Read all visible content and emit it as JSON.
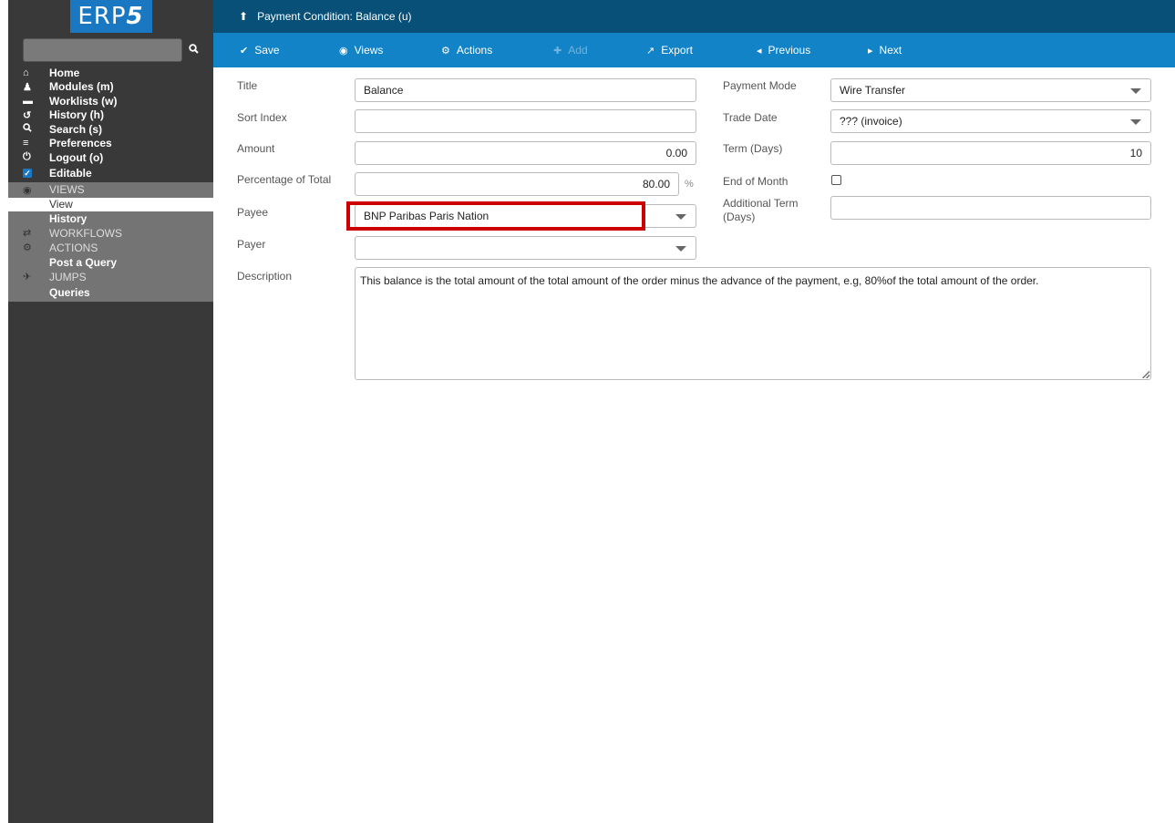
{
  "sidebar": {
    "logo": {
      "text": "ERP",
      "digit": "5"
    },
    "search": {
      "value": "",
      "placeholder": ""
    },
    "items": [
      {
        "label": "Home",
        "icon": "home-icon"
      },
      {
        "label": "Modules (m)",
        "icon": "puzzle-icon"
      },
      {
        "label": "Worklists (w)",
        "icon": "inbox-icon"
      },
      {
        "label": "History (h)",
        "icon": "history-icon"
      },
      {
        "label": "Search (s)",
        "icon": "search-icon"
      },
      {
        "label": "Preferences",
        "icon": "sliders-icon"
      },
      {
        "label": "Logout (o)",
        "icon": "power-icon"
      },
      {
        "label": "Editable",
        "icon": "checkbox-checked-icon"
      }
    ],
    "groups": {
      "views_header": "VIEWS",
      "view": "View",
      "history": "History",
      "workflows_header": "WORKFLOWS",
      "actions_header": "ACTIONS",
      "post_query": "Post a Query",
      "jumps_header": "JUMPS",
      "queries": "Queries"
    }
  },
  "header": {
    "title": "Payment Condition: Balance (u)"
  },
  "toolbar": {
    "save": "Save",
    "views": "Views",
    "actions": "Actions",
    "add": "Add",
    "export": "Export",
    "previous": "Previous",
    "next": "Next"
  },
  "form": {
    "title": {
      "label": "Title",
      "value": "Balance"
    },
    "sort_index": {
      "label": "Sort Index",
      "value": ""
    },
    "amount": {
      "label": "Amount",
      "value": "0.00"
    },
    "percentage": {
      "label": "Percentage of Total",
      "value": "80.00",
      "unit": "%"
    },
    "payee": {
      "label": "Payee",
      "value": "BNP Paribas Paris Nation"
    },
    "payer": {
      "label": "Payer",
      "value": ""
    },
    "description": {
      "label": "Description",
      "value": "This balance is the total amount of the total amount of the order minus the advance of the payment, e.g, 80%of the total amount of the order."
    },
    "payment_mode": {
      "label": "Payment Mode",
      "value": "Wire Transfer"
    },
    "trade_date": {
      "label": "Trade Date",
      "value": "??? (invoice)"
    },
    "term_days": {
      "label": "Term (Days)",
      "value": "10"
    },
    "end_of_month": {
      "label": "End of Month",
      "checked": false
    },
    "additional_term": {
      "label": "Additional Term (Days)",
      "value": ""
    }
  },
  "colors": {
    "header_bg": "#085078",
    "toolbar_bg": "#1183c6",
    "sidebar_bg": "#393939",
    "highlight": "#cc0000"
  }
}
